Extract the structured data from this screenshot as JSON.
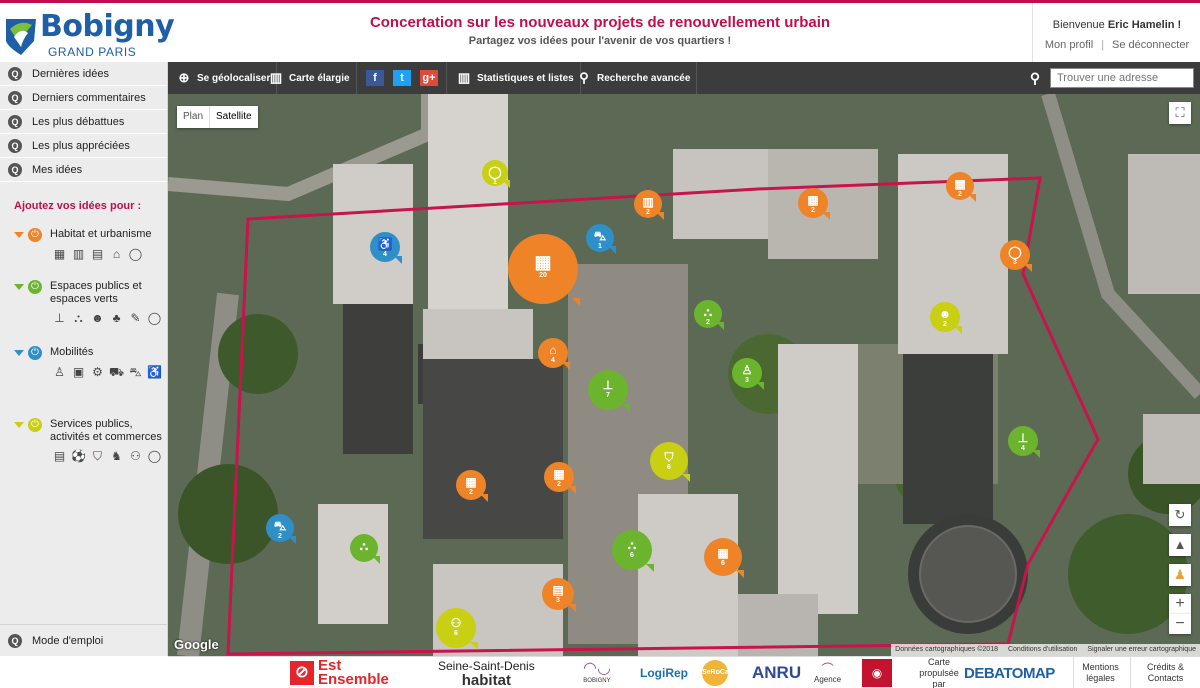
{
  "brand": {
    "name": "Bobigny",
    "sub": "GRAND PARIS",
    "primary": "#1f5fa8",
    "accent": "#c00f4a"
  },
  "header": {
    "title": "Concertation sur les nouveaux projets de renouvellement urbain",
    "subtitle": "Partagez vos idées pour l'avenir de vos quartiers !"
  },
  "user": {
    "welcome_prefix": "Bienvenue ",
    "name": "Eric Hamelin !",
    "profile": "Mon profil",
    "logout": "Se déconnecter"
  },
  "sidebar": {
    "items": [
      {
        "label": "Dernières idées"
      },
      {
        "label": "Derniers commentaires"
      },
      {
        "label": "Les plus débattues"
      },
      {
        "label": "Les plus appréciées"
      },
      {
        "label": "Mes idées"
      }
    ],
    "add_title": "Ajoutez vos idées pour :",
    "categories": [
      {
        "label": "Habitat et urbanisme",
        "color": "#ee8327",
        "icons": [
          "building-icon",
          "apartment-icon",
          "block-icon",
          "house-question-icon",
          "comment-icon"
        ]
      },
      {
        "label": "Espaces publics et espaces verts",
        "color": "#6cb42d",
        "icons": [
          "bench-icon",
          "playground-icon",
          "people-icon",
          "grass-icon",
          "tools-icon",
          "comment-icon"
        ]
      },
      {
        "label": "Mobilités",
        "color": "#2f90c8",
        "icons": [
          "pedestrian-icon",
          "bus-icon",
          "bike-icon",
          "traffic-icon",
          "car-icon",
          "wheelchair-icon"
        ]
      },
      {
        "label": "Services publics, activités et commerces",
        "color": "#c9cf12",
        "icons": [
          "school-icon",
          "sport-icon",
          "shop-icon",
          "culture-icon",
          "market-icon",
          "comment-icon"
        ]
      }
    ],
    "mode_emploi": "Mode d'emploi"
  },
  "toolbar": {
    "locate": "Se géolocaliser",
    "enlarge": "Carte élargie",
    "facebook": "f",
    "twitter": "t",
    "gplus": "g+",
    "stats": "Statistiques et listes",
    "advanced": "Recherche avancée",
    "search_placeholder": "Trouver une adresse"
  },
  "map": {
    "type_plan": "Plan",
    "type_sat": "Satellite",
    "google": "Google",
    "attrib_data": "Données cartographiques ©2018",
    "attrib_terms": "Conditions d'utilisation",
    "attrib_report": "Signaler une erreur cartographique",
    "markers": [
      {
        "cat": "yellow",
        "n": "1",
        "icon": "comment-icon"
      },
      {
        "cat": "blue",
        "n": "1",
        "icon": "car-icon"
      },
      {
        "cat": "blue",
        "n": "4",
        "icon": "wheelchair-icon"
      },
      {
        "cat": "orange",
        "n": "20",
        "icon": "building-icon"
      },
      {
        "cat": "orange",
        "n": "2",
        "icon": "apartment-icon"
      },
      {
        "cat": "orange",
        "n": "2",
        "icon": "building-icon"
      },
      {
        "cat": "orange",
        "n": "2",
        "icon": "building-icon"
      },
      {
        "cat": "orange",
        "n": "3",
        "icon": "comment-icon"
      },
      {
        "cat": "green",
        "n": "2",
        "icon": "playground-icon"
      },
      {
        "cat": "yellow",
        "n": "2",
        "icon": "people-icon"
      },
      {
        "cat": "orange",
        "n": "4",
        "icon": "house-icon"
      },
      {
        "cat": "green",
        "n": "3",
        "icon": "pedestrian-icon"
      },
      {
        "cat": "green",
        "n": "7",
        "icon": "bench-icon"
      },
      {
        "cat": "green",
        "n": "4",
        "icon": "bench-icon"
      },
      {
        "cat": "yellow",
        "n": "6",
        "icon": "shop-icon"
      },
      {
        "cat": "orange",
        "n": "2",
        "icon": "building-icon"
      },
      {
        "cat": "orange",
        "n": "2",
        "icon": "building-icon"
      },
      {
        "cat": "blue",
        "n": "2",
        "icon": "car-icon"
      },
      {
        "cat": "green",
        "n": "",
        "icon": "playground-icon"
      },
      {
        "cat": "green",
        "n": "6",
        "icon": "playground-icon"
      },
      {
        "cat": "orange",
        "n": "6",
        "icon": "building-icon"
      },
      {
        "cat": "orange",
        "n": "3",
        "icon": "block-icon"
      },
      {
        "cat": "yellow",
        "n": "6",
        "icon": "market-icon"
      }
    ]
  },
  "footer": {
    "est1": "Est",
    "est2": "Ensemble",
    "ssd1": "Seine-Saint-Denis",
    "ssd2": "habitat",
    "oph": "BOBIGNY",
    "logirep": "LogiRep",
    "sorema": "SeRoCa",
    "anru": "ANRU",
    "anah": "Agence",
    "cdc": "Groupe Caisse des Dépôts",
    "propulsed": "Carte propulsée par",
    "debatomap": "DEBATOMAP",
    "mentions": "Mentions légales",
    "credits": "Crédits & Contacts"
  }
}
